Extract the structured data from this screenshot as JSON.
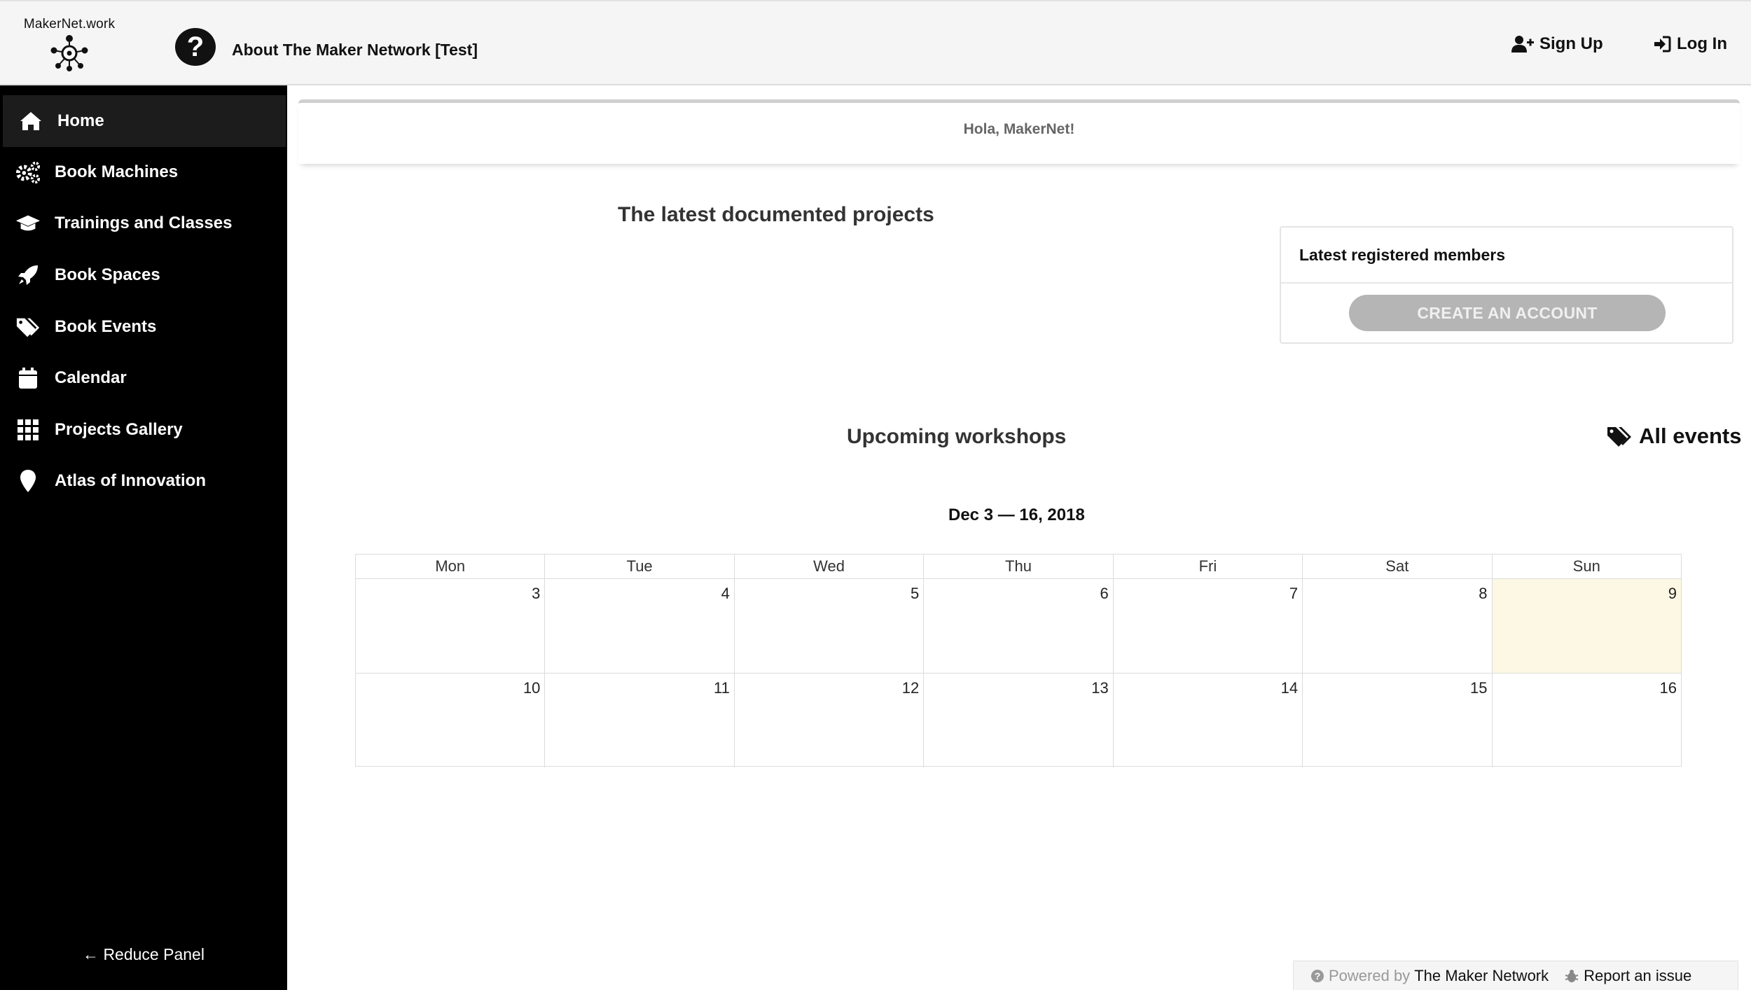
{
  "header": {
    "logo_text": "MakerNet.work",
    "help_label": "?",
    "about_title": "About The Maker Network [Test]",
    "signup_label": "Sign Up",
    "login_label": "Log In"
  },
  "sidebar": {
    "items": [
      {
        "label": "Home",
        "icon": "home-icon",
        "active": true
      },
      {
        "label": "Book Machines",
        "icon": "gears-icon"
      },
      {
        "label": "Trainings and Classes",
        "icon": "graduation-cap-icon"
      },
      {
        "label": "Book Spaces",
        "icon": "rocket-icon"
      },
      {
        "label": "Book Events",
        "icon": "tags-icon"
      },
      {
        "label": "Calendar",
        "icon": "calendar-icon"
      },
      {
        "label": "Projects Gallery",
        "icon": "grid-icon"
      },
      {
        "label": "Atlas of Innovation",
        "icon": "map-marker-icon"
      }
    ],
    "reduce_label": "Reduce Panel"
  },
  "main": {
    "greeting": "Hola, MakerNet!",
    "latest_projects_title": "The latest documented projects",
    "members_card": {
      "title": "Latest registered members",
      "create_button": "CREATE AN ACCOUNT"
    },
    "workshops_title": "Upcoming workshops",
    "all_events_label": "All events",
    "calendar": {
      "range": "Dec 3 — 16, 2018",
      "days": [
        "Mon",
        "Tue",
        "Wed",
        "Thu",
        "Fri",
        "Sat",
        "Sun"
      ],
      "weeks": [
        [
          "3",
          "4",
          "5",
          "6",
          "7",
          "8",
          "9"
        ],
        [
          "10",
          "11",
          "12",
          "13",
          "14",
          "15",
          "16"
        ]
      ],
      "today": "9"
    }
  },
  "footer": {
    "powered_by": "Powered by",
    "powered_name": "The Maker Network",
    "report_label": "Report an issue"
  },
  "colors": {
    "sidebar_bg": "#000000",
    "today_bg": "#fcf8e3",
    "button_disabled": "#b5b5b5"
  }
}
